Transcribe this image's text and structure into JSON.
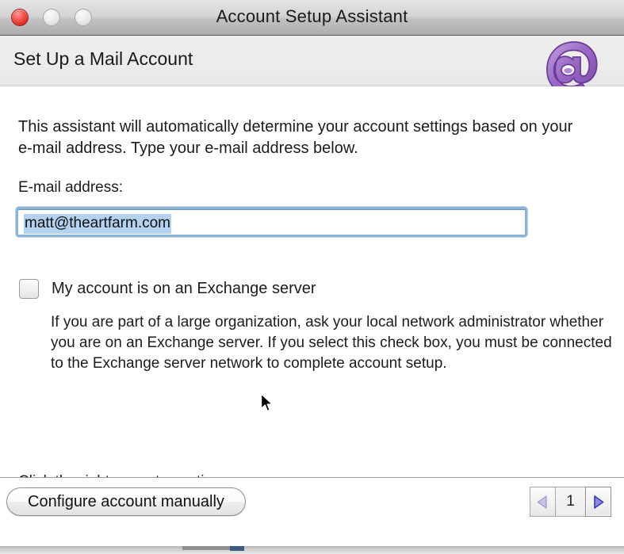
{
  "window": {
    "title": "Account Setup Assistant",
    "controls": {
      "close": "close-button",
      "minimize": "minimize-button",
      "zoom": "zoom-button"
    }
  },
  "header": {
    "title": "Set Up a Mail Account",
    "logo": "entourage-at-logo"
  },
  "content": {
    "intro": "This assistant will automatically determine your account settings based on your e-mail address. Type your e-mail address below.",
    "email_label": "E-mail address:",
    "email_value": "matt@theartfarm.com",
    "email_placeholder": "",
    "checkbox_label": "My account is on an Exchange server",
    "checkbox_checked": false,
    "hint": "If you are part of a large organization, ask your local network administrator whether you are on an Exchange server. If you select this check box, you must be connected to the Exchange server network to complete account setup.",
    "continue_note": "Click the right arrow to continue."
  },
  "footer": {
    "manual_button": "Configure account manually",
    "page_number": "1",
    "prev_arrow": "left-triangle",
    "next_arrow": "right-triangle"
  },
  "colors": {
    "focus_ring": "#8cb4da",
    "selection": "#b4d2f0",
    "logo_purple": "#9b6fc4",
    "prev_arrow": "#b9b9e0",
    "next_arrow": "#4c4cc0",
    "close_red": "#e0392c"
  }
}
